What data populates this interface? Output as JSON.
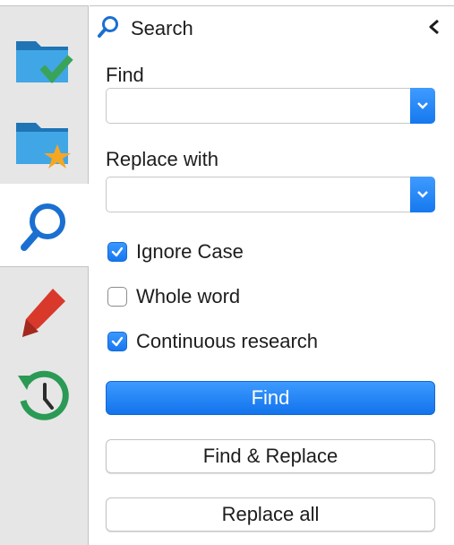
{
  "sidebar": {
    "tabs": [
      {
        "name": "folder-check-icon",
        "active": false
      },
      {
        "name": "folder-star-icon",
        "active": false
      },
      {
        "name": "search-icon",
        "active": true
      },
      {
        "name": "bookmark-icon",
        "active": false
      },
      {
        "name": "history-clock-icon",
        "active": false
      }
    ]
  },
  "panel": {
    "title": "Search",
    "find_label": "Find",
    "find_value": "",
    "replace_label": "Replace with",
    "replace_value": "",
    "options": {
      "ignore_case": {
        "label": "Ignore Case",
        "checked": true
      },
      "whole_word": {
        "label": "Whole word",
        "checked": false
      },
      "continuous": {
        "label": "Continuous research",
        "checked": true
      }
    },
    "buttons": {
      "find": "Find",
      "find_replace": "Find & Replace",
      "replace_all": "Replace all"
    }
  },
  "colors": {
    "accent": "#1a7cf2",
    "folder_blue": "#3aa0e0",
    "check_green": "#3aa35a",
    "star_orange": "#f5a623",
    "bookmark_red": "#d8392b",
    "history_green": "#2a9a55",
    "search_blue": "#1a6fd1"
  }
}
